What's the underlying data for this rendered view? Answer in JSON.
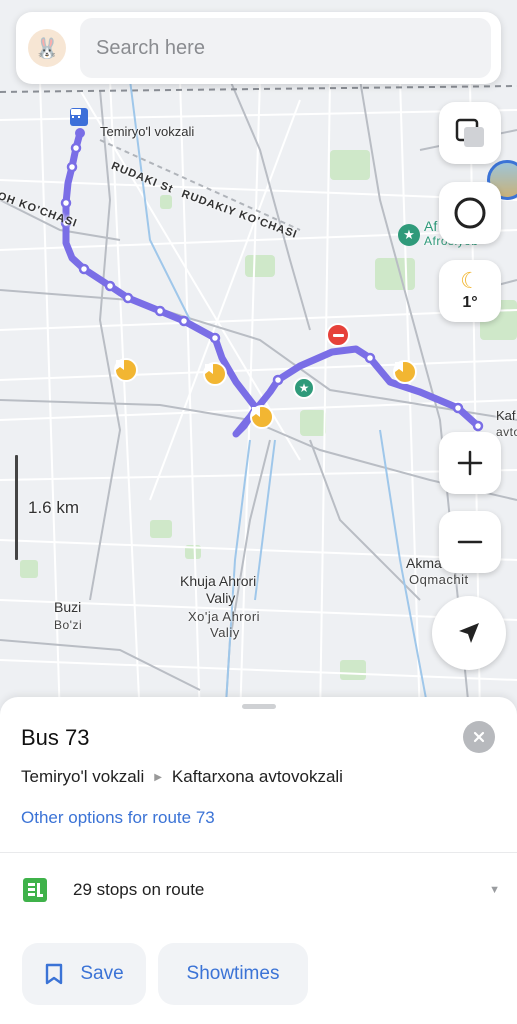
{
  "search": {
    "placeholder": "Search here",
    "avatar_icon": "rabbit-icon"
  },
  "map": {
    "labels": {
      "station": "Temiryo'l vokzali",
      "rudaki_st": "RUDAKI St",
      "rudakiy_kochasi": "RUDAKIY KO'CHASI",
      "oh_kochasi": "OH KO'CHASI",
      "afrosiyob_1": "Af",
      "afrosiyob_2": "Afrosiyob",
      "kaf_1": "Kaf",
      "kaf_2": "avto",
      "khuja_1": "Khuja Ahrori",
      "khuja_2": "Valiy",
      "xoja_1": "Xo'ja Ahrori",
      "xoja_2": "Valiy",
      "buzi_1": "Buzi",
      "buzi_2": "Bo'zi",
      "akmachit_1": "Akmachit",
      "akmachit_2": "Oqmachit"
    },
    "scale_label": "1.6 km",
    "weather_temp": "1°",
    "route_color": "#7a6ee6"
  },
  "sheet": {
    "title": "Bus 73",
    "from_stop": "Temiryo'l vokzali",
    "to_stop": "Kaftarxona avtovokzali",
    "other_options": "Other options for route 73",
    "stops_count": "29 stops on route",
    "save_label": "Save",
    "showtimes_label": "Showtimes"
  }
}
